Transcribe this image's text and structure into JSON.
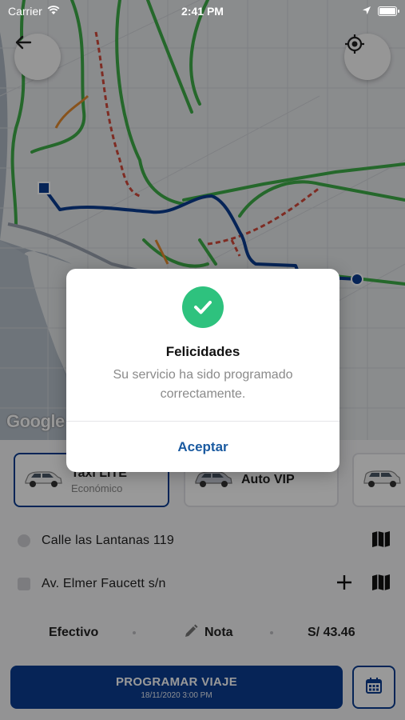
{
  "status_bar": {
    "carrier": "Carrier",
    "time": "2:41 PM",
    "battery_level": 1.0
  },
  "map": {
    "attribution": "Google"
  },
  "vehicles": [
    {
      "name": "Taxi LITE",
      "subtitle": "Económico",
      "selected": true
    },
    {
      "name": "Auto VIP",
      "subtitle": "",
      "selected": false
    },
    {
      "name": "",
      "subtitle": "",
      "selected": false
    }
  ],
  "route": {
    "origin": "Calle las Lantanas 119",
    "destination": "Av. Elmer Faucett s/n"
  },
  "payment": {
    "method": "Efectivo",
    "note_label": "Nota",
    "price": "S/ 43.46"
  },
  "schedule": {
    "button_label": "PROGRAMAR VIAJE",
    "datetime": "18/11/2020 3:00 PM"
  },
  "dialog": {
    "title": "Felicidades",
    "message": "Su servicio ha sido programado correctamente.",
    "accept_label": "Aceptar"
  },
  "colors": {
    "primary": "#0b3d91",
    "success": "#2ec27e",
    "link": "#1a5aa0"
  }
}
